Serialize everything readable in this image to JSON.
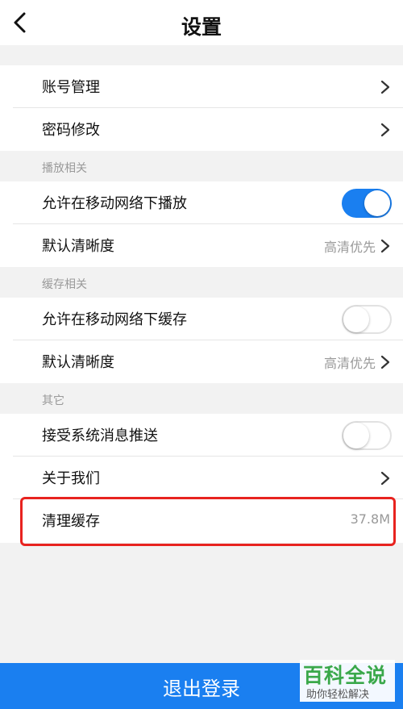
{
  "header": {
    "title": "设置",
    "back_icon": "chevron-left-icon"
  },
  "group1": [
    {
      "label": "账号管理"
    },
    {
      "label": "密码修改"
    }
  ],
  "sections": {
    "playback": "播放相关",
    "cache": "缓存相关",
    "other": "其它"
  },
  "playback": {
    "allow_mobile": {
      "label": "允许在移动网络下播放",
      "enabled": true
    },
    "default_quality": {
      "label": "默认清晰度",
      "value": "高清优先"
    }
  },
  "cache": {
    "allow_mobile": {
      "label": "允许在移动网络下缓存",
      "enabled": false
    },
    "default_quality": {
      "label": "默认清晰度",
      "value": "高清优先"
    }
  },
  "other": {
    "push": {
      "label": "接受系统消息推送",
      "enabled": false
    },
    "about": {
      "label": "关于我们"
    },
    "clear_cache": {
      "label": "清理缓存",
      "value": "37.8M"
    }
  },
  "logout_label": "退出登录",
  "watermark": {
    "title": "百科全说",
    "subtitle": "助你轻松解决"
  },
  "colors": {
    "accent": "#1a7ff0",
    "highlight": "#e8231f",
    "watermark": "#3aa84a"
  }
}
